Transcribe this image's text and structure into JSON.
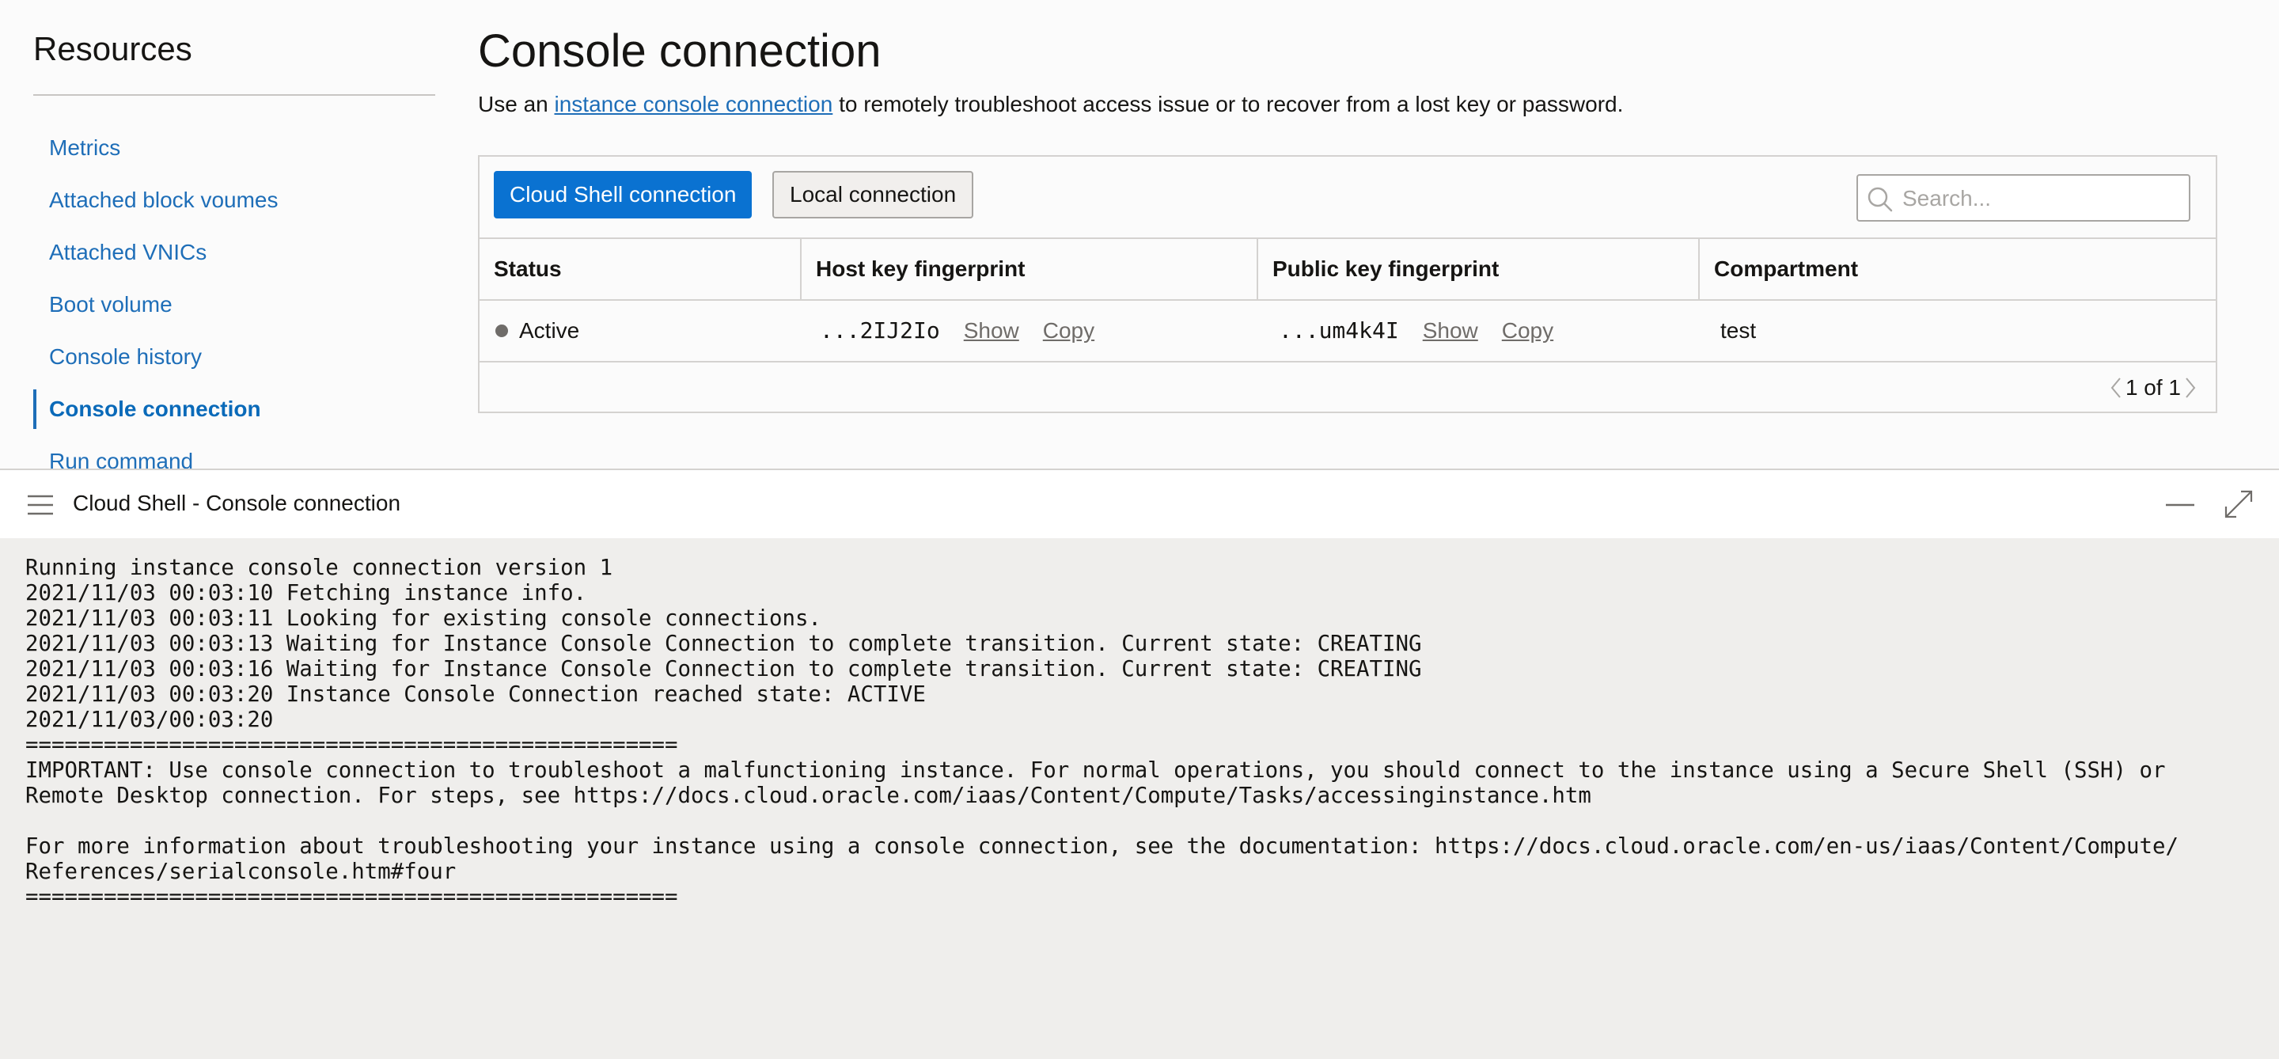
{
  "sidebar": {
    "title": "Resources",
    "items": [
      {
        "label": "Metrics",
        "active": false
      },
      {
        "label": "Attached block voumes",
        "active": false
      },
      {
        "label": "Attached VNICs",
        "active": false
      },
      {
        "label": "Boot volume",
        "active": false
      },
      {
        "label": "Console history",
        "active": false
      },
      {
        "label": "Console connection",
        "active": true
      },
      {
        "label": "Run command",
        "active": false
      }
    ]
  },
  "main": {
    "title": "Console connection",
    "desc_prefix": "Use an ",
    "desc_link": "instance console connection",
    "desc_suffix": " to remotely troubleshoot access issue or to recover from a lost key or password."
  },
  "toolbar": {
    "cloud_shell_label": "Cloud Shell connection",
    "local_label": "Local connection",
    "search_placeholder": "Search..."
  },
  "table": {
    "headers": [
      "Status",
      "Host key fingerprint",
      "Public key fingerprint",
      "Compartment"
    ],
    "row": {
      "status": "Active",
      "host_fp": "...2IJ2Io",
      "public_fp": "...um4k4I",
      "show": "Show",
      "copy": "Copy",
      "compartment": "test"
    },
    "pager": "1 of 1"
  },
  "colors": {
    "accent": "#0a72d1",
    "link": "#1e6eb8",
    "terminal_bg": "#efeeec"
  },
  "shell": {
    "title": "Cloud Shell - Console connection",
    "lines": [
      "Running instance console connection version 1",
      "2021/11/03 00:03:10 Fetching instance info.",
      "2021/11/03 00:03:11 Looking for existing console connections.",
      "2021/11/03 00:03:13 Waiting for Instance Console Connection to complete transition. Current state: CREATING",
      "2021/11/03 00:03:16 Waiting for Instance Console Connection to complete transition. Current state: CREATING",
      "2021/11/03 00:03:20 Instance Console Connection reached state: ACTIVE",
      "2021/11/03/00:03:20",
      "==================================================",
      "IMPORTANT: Use console connection to troubleshoot a malfunctioning instance. For normal operations, you should connect to the instance using a Secure Shell (SSH) or",
      "Remote Desktop connection. For steps, see https://docs.cloud.oracle.com/iaas/Content/Compute/Tasks/accessinginstance.htm",
      "",
      "For more information about troubleshooting your instance using a console connection, see the documentation: https://docs.cloud.oracle.com/en-us/iaas/Content/Compute/",
      "References/serialconsole.htm#four",
      "=================================================="
    ]
  }
}
